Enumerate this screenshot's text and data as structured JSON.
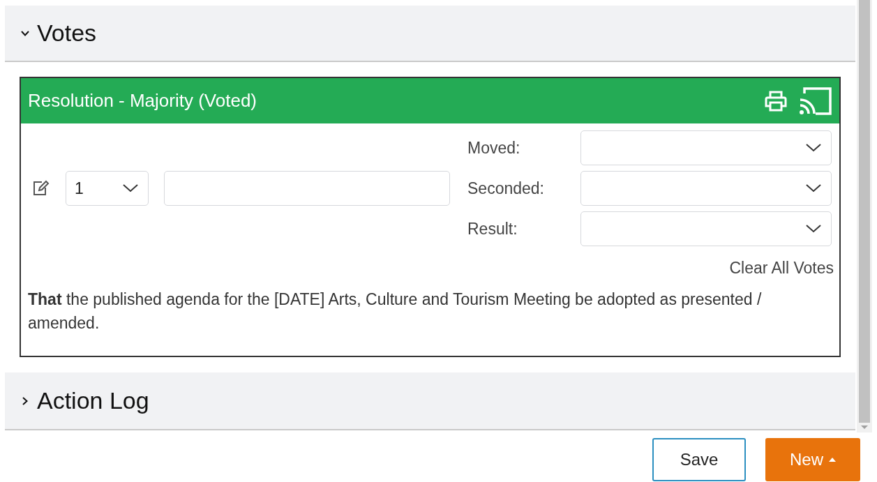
{
  "sections": [
    {
      "title": "Votes",
      "expanded": true,
      "card": {
        "title": "Resolution - Majority (Voted)",
        "number_select": {
          "value": "1"
        },
        "vote_fields": [
          {
            "label": "Moved:"
          },
          {
            "label": "Seconded:"
          },
          {
            "label": "Result:"
          }
        ],
        "clear_link": "Clear All Votes",
        "motion": "**That** the published agenda for the [DATE] Arts, Culture and Tourism Meeting be adopted as presented / amended."
      }
    },
    {
      "title": "Action Log",
      "expanded": false
    }
  ],
  "buttons": [
    {
      "label": "Save",
      "kind": "outline"
    },
    {
      "label": "New",
      "kind": "dropdown"
    }
  ]
}
